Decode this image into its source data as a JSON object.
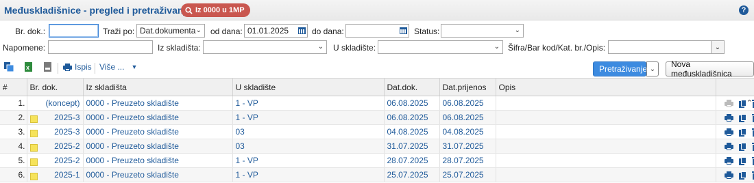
{
  "header": {
    "title": "Međuskladišnice - pregled i pretraživanje",
    "badge_label": "Iz 0000 u 1MP",
    "help": "?"
  },
  "filters": {
    "br_dok_label": "Br. dok.:",
    "br_dok_value": "",
    "trazi_po_label": "Traži po:",
    "trazi_po_value": "Dat.dokumenta",
    "od_dana_label": "od dana:",
    "od_dana_value": "01.01.2025",
    "do_dana_label": "do dana:",
    "do_dana_value": "",
    "status_label": "Status:",
    "status_value": "",
    "napomene_label": "Napomene:",
    "napomene_value": "",
    "iz_skladista_label": "Iz skladišta:",
    "iz_skladista_value": "",
    "u_skladiste_label": "U skladište:",
    "u_skladiste_value": "",
    "sifra_label": "Šifra/Bar kod/Kat. br./Opis:",
    "sifra_value": ""
  },
  "toolbar": {
    "print_label": "Ispis",
    "more_label": "Više ...",
    "search_label": "Pretraživanje",
    "new_label": "Nova međuskladišnica"
  },
  "table": {
    "columns": [
      "#",
      "Br. dok.",
      "Iz skladišta",
      "U skladište",
      "Dat.dok.",
      "Dat.prijenos",
      "Opis"
    ],
    "rows": [
      {
        "idx": "1.",
        "flag": false,
        "brdok": "(koncept)",
        "iz": "0000 - Preuzeto skladište",
        "u": "1 - VP",
        "datdok": "06.08.2025",
        "datprij": "06.08.2025",
        "opis": "",
        "print_enabled": false
      },
      {
        "idx": "2.",
        "flag": true,
        "brdok": "2025-3",
        "iz": "0000 - Preuzeto skladište",
        "u": "1 - VP",
        "datdok": "06.08.2025",
        "datprij": "06.08.2025",
        "opis": "",
        "print_enabled": true
      },
      {
        "idx": "3.",
        "flag": true,
        "brdok": "2025-3",
        "iz": "0000 - Preuzeto skladište",
        "u": "03",
        "datdok": "04.08.2025",
        "datprij": "04.08.2025",
        "opis": "",
        "print_enabled": true
      },
      {
        "idx": "4.",
        "flag": true,
        "brdok": "2025-2",
        "iz": "0000 - Preuzeto skladište",
        "u": "03",
        "datdok": "31.07.2025",
        "datprij": "31.07.2025",
        "opis": "",
        "print_enabled": true
      },
      {
        "idx": "5.",
        "flag": true,
        "brdok": "2025-2",
        "iz": "0000 - Preuzeto skladište",
        "u": "1 - VP",
        "datdok": "28.07.2025",
        "datprij": "28.07.2025",
        "opis": "",
        "print_enabled": true
      },
      {
        "idx": "6.",
        "flag": true,
        "brdok": "2025-1",
        "iz": "0000 - Preuzeto skladište",
        "u": "1 - VP",
        "datdok": "25.07.2025",
        "datprij": "25.07.2025",
        "opis": "",
        "print_enabled": true
      }
    ]
  },
  "icons": {
    "badge": "search-icon",
    "help": "help-icon",
    "calendar": "calendar-icon",
    "print": "printer-icon",
    "copy": "copy-icon",
    "delete": "trash-icon",
    "export": [
      "copy-export-icon",
      "excel-icon",
      "pdf-icon"
    ]
  },
  "colors": {
    "accent": "#1f5a9a",
    "badge_bg": "#c9574f",
    "primary_btn": "#3d8be0",
    "flag": "#f6e35a"
  }
}
